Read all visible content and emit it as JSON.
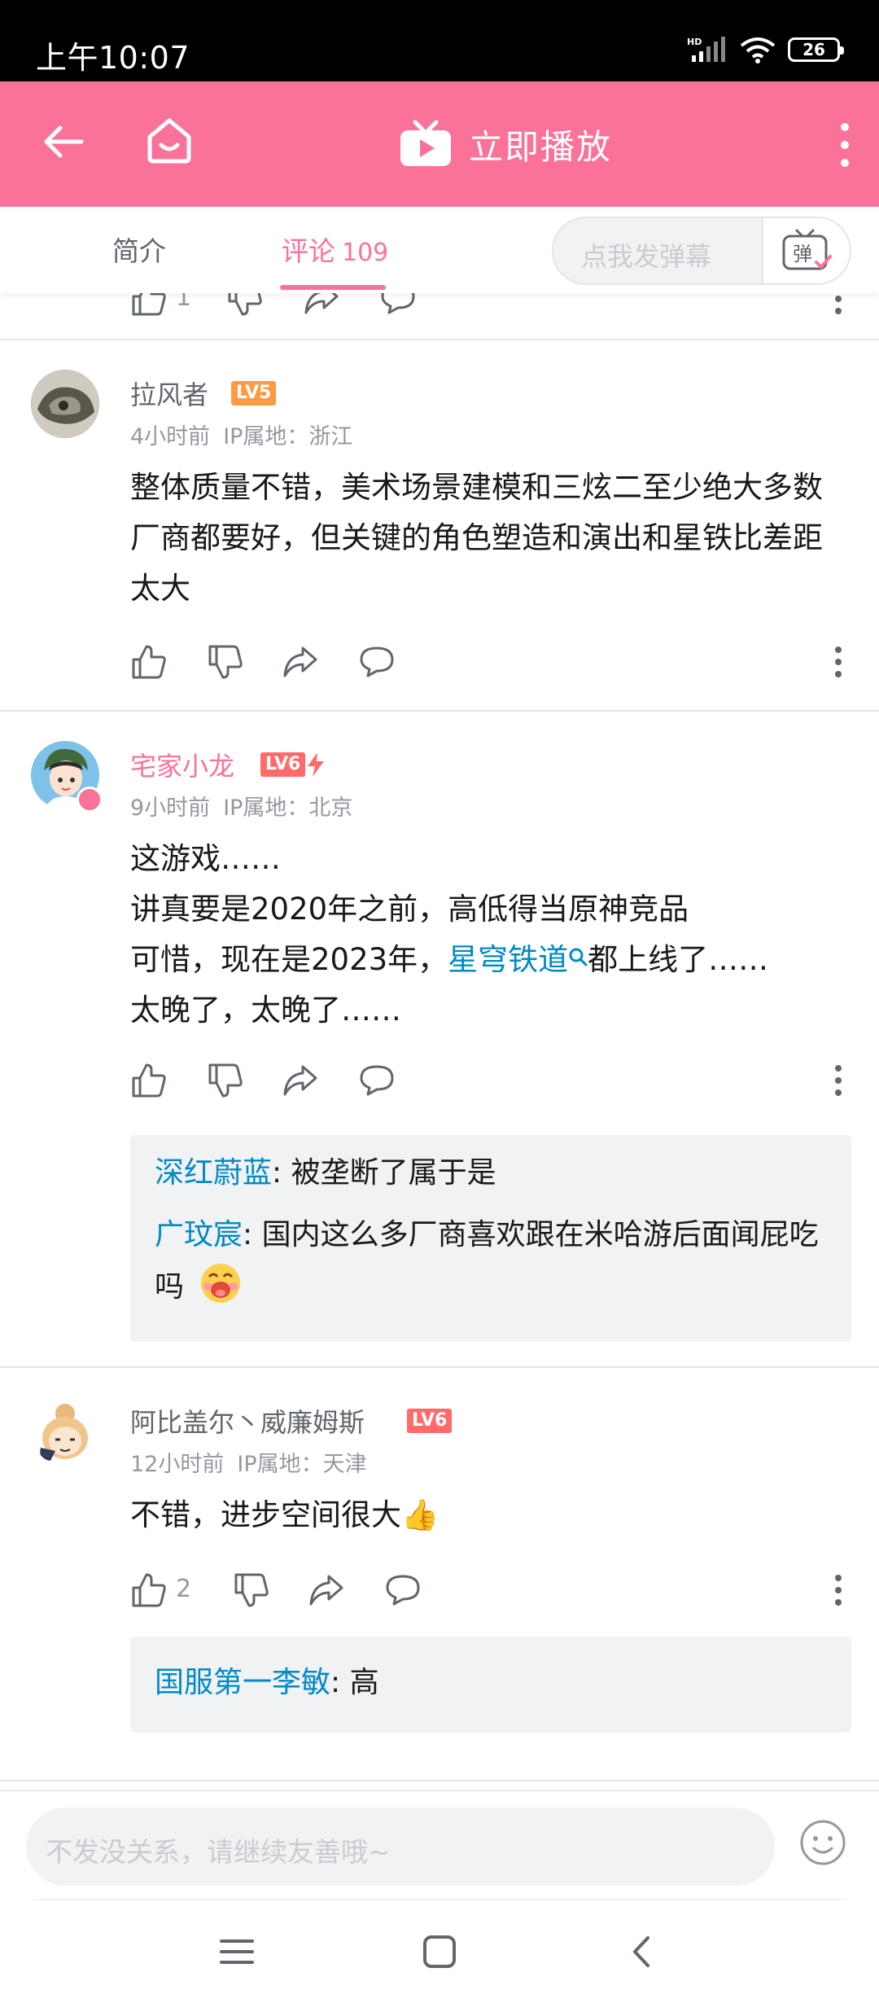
{
  "status_bar": {
    "time": "上午10:07",
    "network_label": "HD",
    "battery": "26"
  },
  "header": {
    "play_label": "立即播放",
    "icons": [
      "back-arrow-icon",
      "home-icon",
      "tv-play-icon",
      "more-vertical-icon"
    ],
    "brand_color": "#fb7299"
  },
  "tabs": {
    "intro": "简介",
    "comments_label": "评论",
    "comments_count": "109",
    "danmaku_placeholder": "点我发弹幕",
    "danmaku_button": "弹"
  },
  "partial_row": {
    "like_count": "1"
  },
  "comments": [
    {
      "username": "拉风者",
      "level": "LV5",
      "time": "4小时前",
      "ip": "IP属地：浙江",
      "text": "整体质量不错，美术场景建模和三炫二至少绝大多数厂商都要好，但关键的角色塑造和演出和星铁比差距太大"
    },
    {
      "username": "宅家小龙",
      "level": "LV6",
      "time": "9小时前",
      "ip": "IP属地：北京",
      "lines": [
        "这游戏……",
        "讲真要是2020年之前，高低得当原神竞品",
        "可惜，现在是2023年，",
        "星穹铁道",
        "都上线了……",
        "太晚了，太晚了……"
      ],
      "replies": [
        {
          "name": "深红蔚蓝",
          "text": ": 被垄断了属于是"
        },
        {
          "name": "广玟宸",
          "text": ": 国内这么多厂商喜欢跟在米哈游后面闻屁吃吗"
        }
      ]
    },
    {
      "username": "阿比盖尔丶威廉姆斯",
      "level": "LV6",
      "time": "12小时前",
      "ip": "IP属地：天津",
      "text": "不错，进步空间很大👍",
      "like_count": "2",
      "replies": [
        {
          "name": "国服第一李敏",
          "text": ": 高"
        }
      ]
    }
  ],
  "input": {
    "placeholder": "不发没关系，请继续友善哦~"
  }
}
